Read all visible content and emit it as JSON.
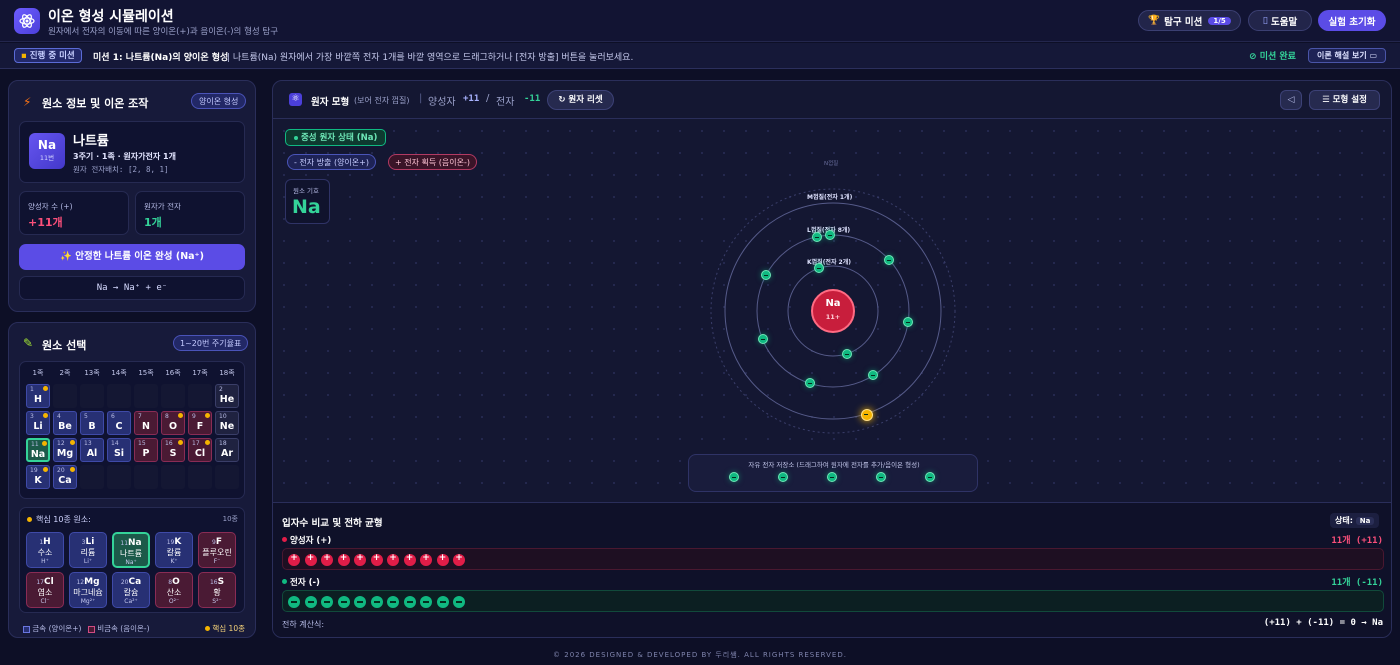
{
  "header": {
    "title": "이온 형성 시뮬레이션",
    "subtitle": "원자에서 전자의 이동에 따른 양이온(+)과 음이온(-)의 형성 탐구",
    "mission_btn": "탐구 미션",
    "mission_count": "1/5",
    "help_btn": "도움말",
    "reset_btn": "실험 초기화"
  },
  "mission": {
    "badge": "진행 중 미션",
    "title": "미션 1: 나트륨(Na)의 양이온 형성",
    "desc": "| 나트륨(Na) 원자에서 가장 바깥쪽 전자 1개를 바깥 영역으로 드래그하거나 [전자 방출] 버튼을 눌러보세요.",
    "done": "미션 완료",
    "theory_btn": "이론 해설 보기"
  },
  "element_info": {
    "title": "원소 정보 및 이온 조작",
    "badge": "양이온 형성",
    "symbol": "Na",
    "number": "11번",
    "name": "나트륨",
    "desc": "3주기 · 1족 · 원자가전자 1개",
    "config": "원자 전자배치: [2, 8, 1]",
    "proton_label": "양성자 수 (+)",
    "proton_value": "+11개",
    "valence_label": "원자가 전자",
    "valence_value": "1개",
    "complete_btn": "안정한 나트륨 이온 완성 (Na⁺)",
    "equation": "Na → Na⁺ + e⁻"
  },
  "selector": {
    "title": "원소 선택",
    "badge": "1~20번 주기율표",
    "groups": [
      "1족",
      "2족",
      "13족",
      "14족",
      "15족",
      "16족",
      "17족",
      "18족"
    ],
    "cells": [
      {
        "n": "1",
        "s": "H",
        "t": "metal",
        "c": 0,
        "r": 0,
        "d": true
      },
      {
        "n": "2",
        "s": "He",
        "t": "noble",
        "c": 7,
        "r": 0,
        "d": false
      },
      {
        "n": "3",
        "s": "Li",
        "t": "metal",
        "c": 0,
        "r": 1,
        "d": true
      },
      {
        "n": "4",
        "s": "Be",
        "t": "metal",
        "c": 1,
        "r": 1,
        "d": false
      },
      {
        "n": "5",
        "s": "B",
        "t": "metal",
        "c": 2,
        "r": 1,
        "d": false
      },
      {
        "n": "6",
        "s": "C",
        "t": "metal",
        "c": 3,
        "r": 1,
        "d": false
      },
      {
        "n": "7",
        "s": "N",
        "t": "nonmetal",
        "c": 4,
        "r": 1,
        "d": false
      },
      {
        "n": "8",
        "s": "O",
        "t": "nonmetal",
        "c": 5,
        "r": 1,
        "d": true
      },
      {
        "n": "9",
        "s": "F",
        "t": "nonmetal",
        "c": 6,
        "r": 1,
        "d": true
      },
      {
        "n": "10",
        "s": "Ne",
        "t": "noble",
        "c": 7,
        "r": 1,
        "d": false
      },
      {
        "n": "11",
        "s": "Na",
        "t": "metal",
        "c": 0,
        "r": 2,
        "d": true,
        "sel": true
      },
      {
        "n": "12",
        "s": "Mg",
        "t": "metal",
        "c": 1,
        "r": 2,
        "d": true
      },
      {
        "n": "13",
        "s": "Al",
        "t": "metal",
        "c": 2,
        "r": 2,
        "d": false
      },
      {
        "n": "14",
        "s": "Si",
        "t": "metal",
        "c": 3,
        "r": 2,
        "d": false
      },
      {
        "n": "15",
        "s": "P",
        "t": "nonmetal",
        "c": 4,
        "r": 2,
        "d": false
      },
      {
        "n": "16",
        "s": "S",
        "t": "nonmetal",
        "c": 5,
        "r": 2,
        "d": true
      },
      {
        "n": "17",
        "s": "Cl",
        "t": "nonmetal",
        "c": 6,
        "r": 2,
        "d": true
      },
      {
        "n": "18",
        "s": "Ar",
        "t": "noble",
        "c": 7,
        "r": 2,
        "d": false
      },
      {
        "n": "19",
        "s": "K",
        "t": "metal",
        "c": 0,
        "r": 3,
        "d": true
      },
      {
        "n": "20",
        "s": "Ca",
        "t": "metal",
        "c": 1,
        "r": 3,
        "d": true
      }
    ],
    "core_title": "핵심 10종 원소:",
    "core_count": "10종",
    "core": [
      {
        "n": "1",
        "s": "H",
        "name": "수소",
        "ion": "H⁺",
        "t": "metal"
      },
      {
        "n": "3",
        "s": "Li",
        "name": "리튬",
        "ion": "Li⁺",
        "t": "metal"
      },
      {
        "n": "11",
        "s": "Na",
        "name": "나트륨",
        "ion": "Na⁺",
        "t": "metal",
        "sel": true
      },
      {
        "n": "19",
        "s": "K",
        "name": "칼륨",
        "ion": "K⁺",
        "t": "metal"
      },
      {
        "n": "9",
        "s": "F",
        "name": "플루오린",
        "ion": "F⁻",
        "t": "nonmetal"
      },
      {
        "n": "17",
        "s": "Cl",
        "name": "염소",
        "ion": "Cl⁻",
        "t": "nonmetal"
      },
      {
        "n": "12",
        "s": "Mg",
        "name": "마그네슘",
        "ion": "Mg²⁺",
        "t": "metal"
      },
      {
        "n": "20",
        "s": "Ca",
        "name": "칼슘",
        "ion": "Ca²⁺",
        "t": "metal"
      },
      {
        "n": "8",
        "s": "O",
        "name": "산소",
        "ion": "O²⁻",
        "t": "nonmetal"
      },
      {
        "n": "16",
        "s": "S",
        "name": "황",
        "ion": "S²⁻",
        "t": "nonmetal"
      }
    ],
    "legend_metal": "금속 (양이온+)",
    "legend_nonmetal": "비금속 (음이온-)",
    "legend_core": "핵심 10종"
  },
  "model": {
    "title": "원자 모형",
    "subtitle": "(보어 전자 껍질)",
    "proton_label": "양성자",
    "proton_value": "+11",
    "sep": "/",
    "electron_label": "전자",
    "electron_value": "-11",
    "reset_btn": "원자 리셋",
    "settings_btn": "모형 설정",
    "state_badge": "중성 원자 상태 (Na)",
    "emit_btn": "- 전자 방출 (양이온+)",
    "gain_btn": "+ 전자 획득 (음이온-)",
    "symbol_label": "원소 기호",
    "symbol": "Na",
    "shell_m": "M껍질(전자 1개)",
    "shell_l": "L껍질(전자 8개)",
    "shell_k": "K껍질(전자 2개)",
    "shell_outer": "N껍질",
    "nucleus_symbol": "Na",
    "nucleus_charge": "11+",
    "pool_label": "자유 전자 저장소 (드래그하여 원자에 전자를 추가/음이온 형성)"
  },
  "balance": {
    "title": "입자수 비교 및 전하 균형",
    "state_label": "상태:",
    "state_value": "Na",
    "proton_label": "양성자 (+)",
    "proton_count": "11개 (+11)",
    "electron_label": "전자 (-)",
    "electron_count": "11개 (-11)",
    "calc_label": "전하 계산식:",
    "calc_value": "(+11) + (-11) = 0 → Na",
    "proton_n": 11,
    "electron_n": 11
  },
  "footer": {
    "text": "© 2026 DESIGNED & DEVELOPED BY 두리쌤. ALL RIGHTS RESERVED."
  },
  "colors": {
    "accent": "#6d5cff",
    "proton": "#e11d48",
    "electron": "#10b981",
    "highlight": "#f5b400"
  }
}
